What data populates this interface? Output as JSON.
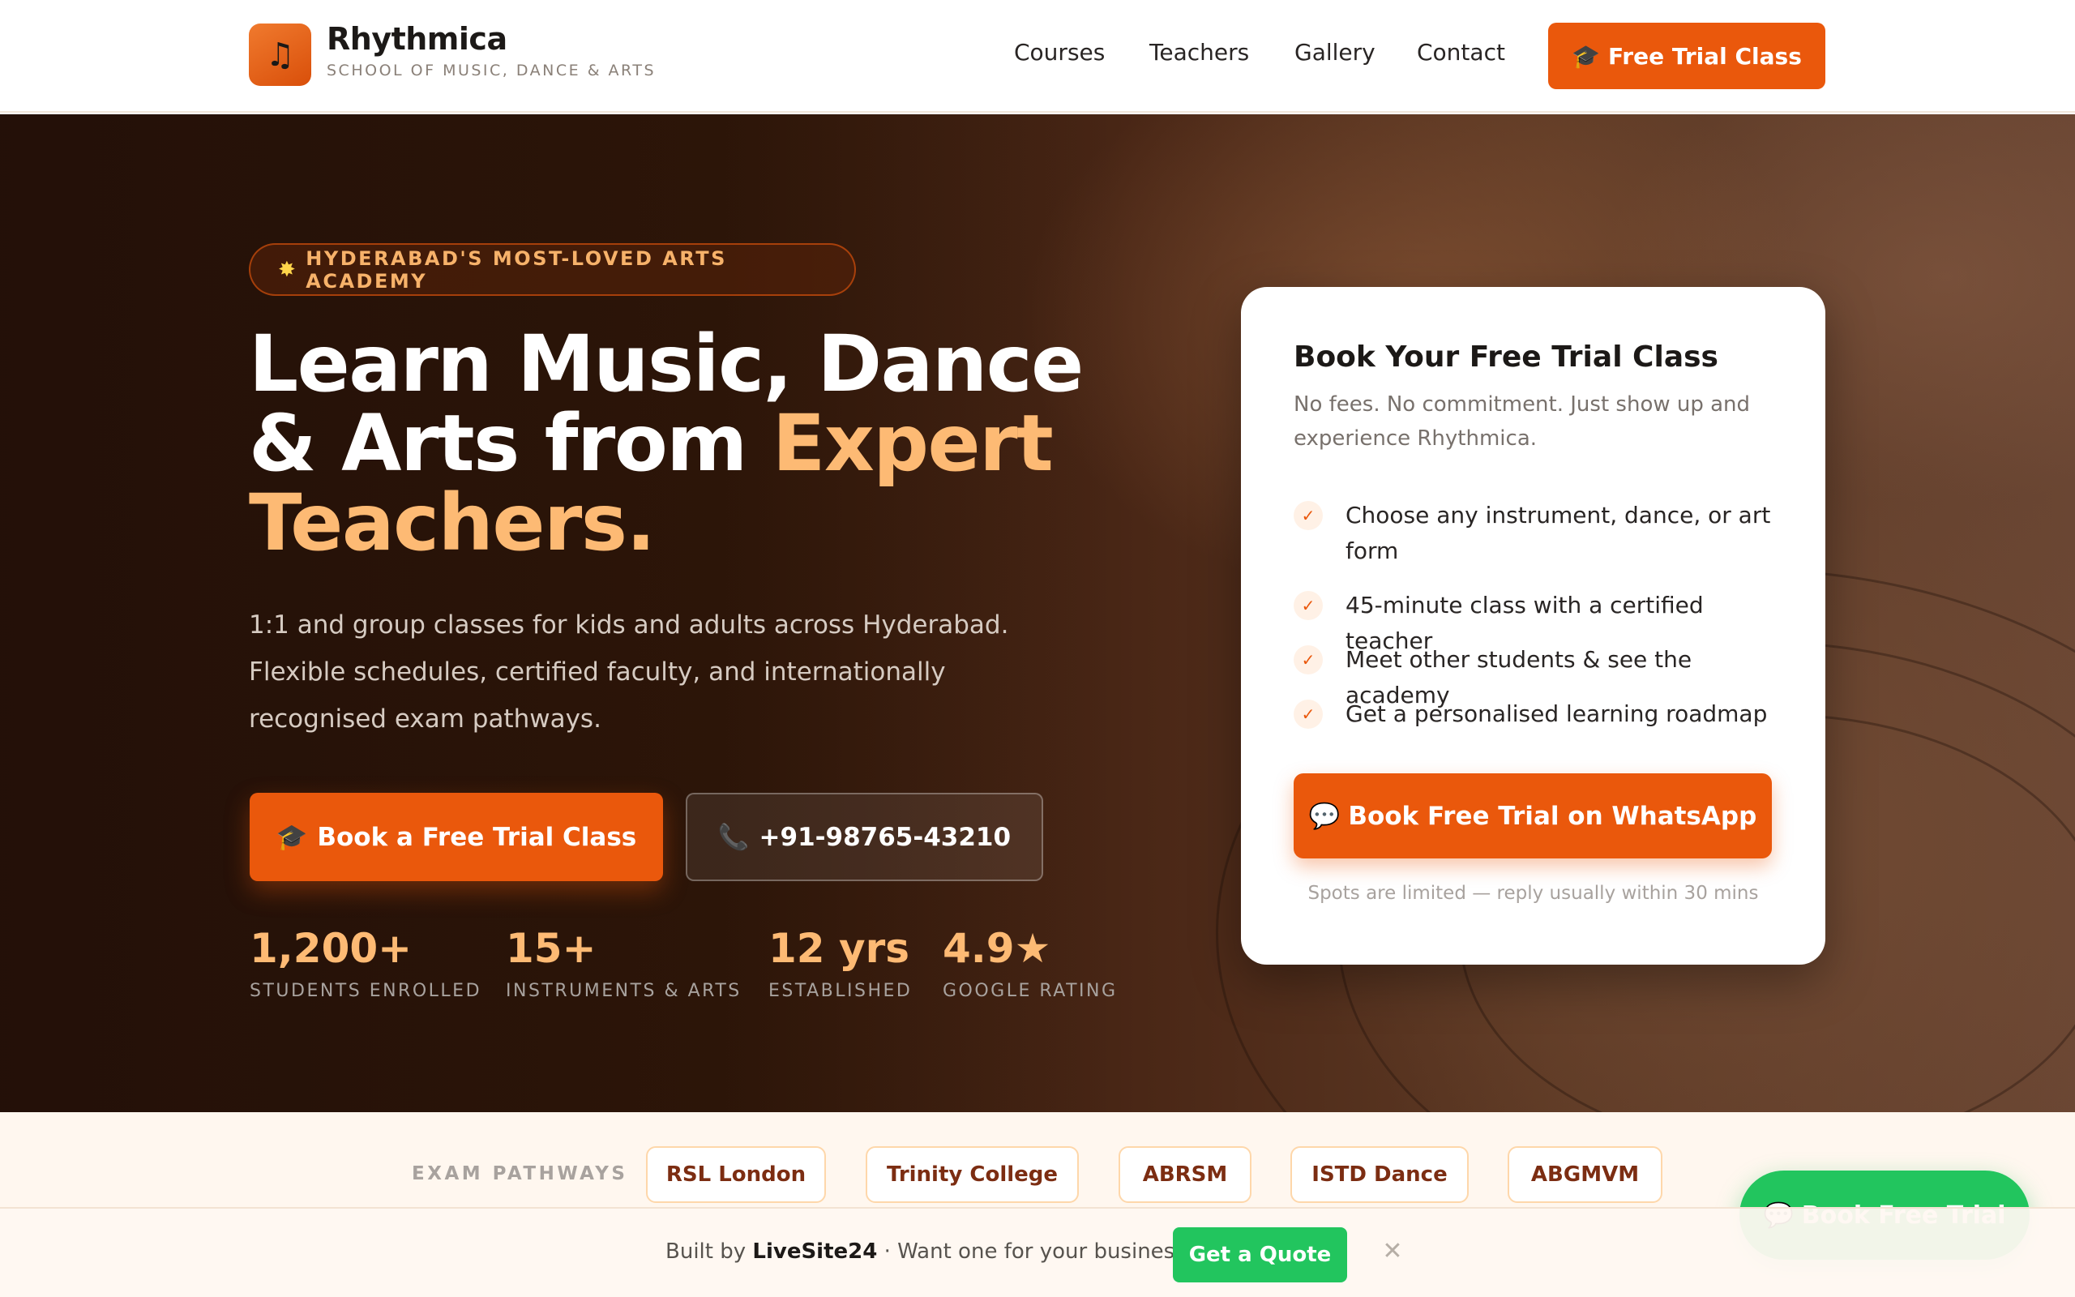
{
  "header": {
    "logo_icon": "music-note-icon",
    "brand_name": "Rhythmica",
    "brand_tagline": "SCHOOL OF MUSIC, DANCE & ARTS",
    "nav": [
      "Courses",
      "Teachers",
      "Gallery",
      "Contact"
    ],
    "cta_label": "Free Trial Class"
  },
  "hero": {
    "badge": "HYDERABAD'S MOST-LOVED ARTS ACADEMY",
    "headline_part1": "Learn Music, Dance & Arts from ",
    "headline_highlight": "Expert Teachers.",
    "subtext": "1:1 and group classes for kids and adults across Hyderabad. Flexible schedules, certified faculty, and internationally recognised exam pathways.",
    "primary_cta": "Book a Free Trial Class",
    "phone_cta": "+91-98765-43210",
    "stats": [
      {
        "value": "1,200+",
        "label": "STUDENTS ENROLLED"
      },
      {
        "value": "15+",
        "label": "INSTRUMENTS & ARTS"
      },
      {
        "value": "12 yrs",
        "label": "ESTABLISHED"
      },
      {
        "value": "4.9★",
        "label": "GOOGLE RATING"
      }
    ]
  },
  "trial_card": {
    "title": "Book Your Free Trial Class",
    "description": "No fees. No commitment. Just show up and experience Rhythmica.",
    "benefits": [
      "Choose any instrument, dance, or art form",
      "45-minute class with a certified teacher",
      "Meet other students & see the academy",
      "Get a personalised learning roadmap"
    ],
    "button_label": "Book Free Trial on WhatsApp",
    "note": "Spots are limited — reply usually within 30 mins"
  },
  "exams": {
    "label": "EXAM PATHWAYS",
    "items": [
      "RSL London",
      "Trinity College",
      "ABRSM",
      "ISTD Dance",
      "ABGMVM"
    ]
  },
  "floating_whatsapp": {
    "label": "Book Free Trial"
  },
  "bottom_bar": {
    "built_by_prefix": "Built by",
    "builder": "LiveSite24",
    "question": "· Want one for your business?",
    "quote_button": "Get a Quote",
    "close_icon": "close-icon"
  },
  "colors": {
    "accent": "#ea580c",
    "highlight": "#fdba74",
    "whatsapp_green": "#22c55e"
  }
}
